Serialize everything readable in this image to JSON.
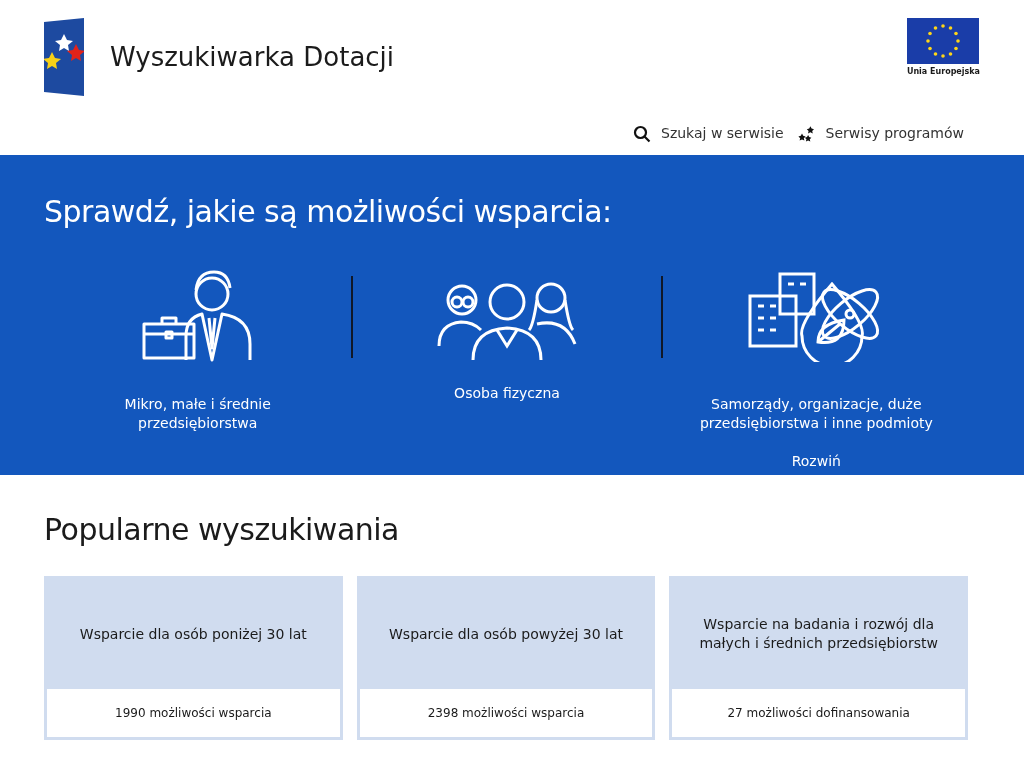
{
  "header": {
    "title": "Wyszukiwarka Dotacji",
    "eu_label": "Unia Europejska"
  },
  "nav": [
    {
      "label": "Szukaj w serwisie",
      "kind": "search"
    },
    {
      "label": "Serwisy programów",
      "kind": "programs"
    }
  ],
  "hero": {
    "heading": "Sprawdź, jakie są możliwości wsparcia:",
    "options": [
      {
        "label": "Mikro, małe i średnie przedsiębiorstwa",
        "kind": "business"
      },
      {
        "label": "Osoba fizyczna",
        "kind": "person"
      },
      {
        "label": "Samorządy, organizacje, duże przedsiębiorstwa i inne podmioty",
        "kind": "institution",
        "more": "Rozwiń"
      }
    ]
  },
  "popular": {
    "heading": "Popularne wyszukiwania",
    "cards": [
      {
        "title": "Wsparcie dla osób poniżej 30 lat",
        "count": "1990 możliwości wsparcia"
      },
      {
        "title": "Wsparcie dla osób powyżej 30 lat",
        "count": "2398 możliwości wsparcia"
      },
      {
        "title": "Wsparcie na badania i rozwój dla małych i średnich przedsiębiorstw",
        "count": "27 możliwości dofinansowania"
      }
    ]
  }
}
